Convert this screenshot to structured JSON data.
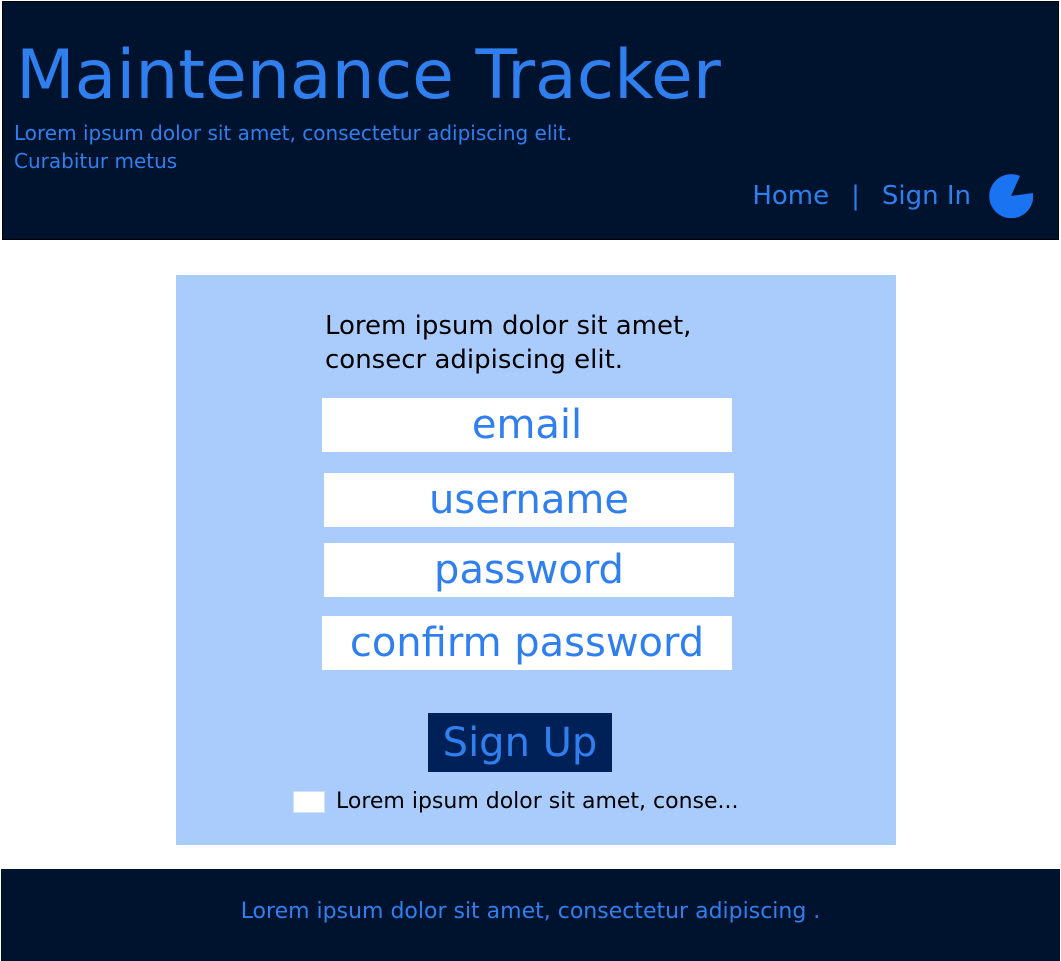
{
  "header": {
    "title": "Maintenance Tracker",
    "tagline_line1": "Lorem ipsum dolor sit amet, consectetur adipiscing elit.",
    "tagline_line2": "Curabitur metus",
    "nav": {
      "home": "Home",
      "separator": "|",
      "sign_in": "Sign In",
      "user_icon": "user-avatar-icon"
    }
  },
  "form": {
    "intro_line1": "Lorem ipsum dolor sit amet,",
    "intro_line2": "consecr adipiscing elit.",
    "email_placeholder": "email",
    "username_placeholder": "username",
    "password_placeholder": "password",
    "confirm_password_placeholder": "confirm password",
    "submit_label": "Sign Up",
    "terms_label": "Lorem ipsum dolor sit amet, conse..."
  },
  "footer": {
    "text": "Lorem ipsum dolor sit amet, consectetur adipiscing ."
  },
  "colors": {
    "header_bg": "#00132e",
    "accent": "#2f7fee",
    "card_bg": "#a9ccfd",
    "button_bg": "#002158"
  }
}
